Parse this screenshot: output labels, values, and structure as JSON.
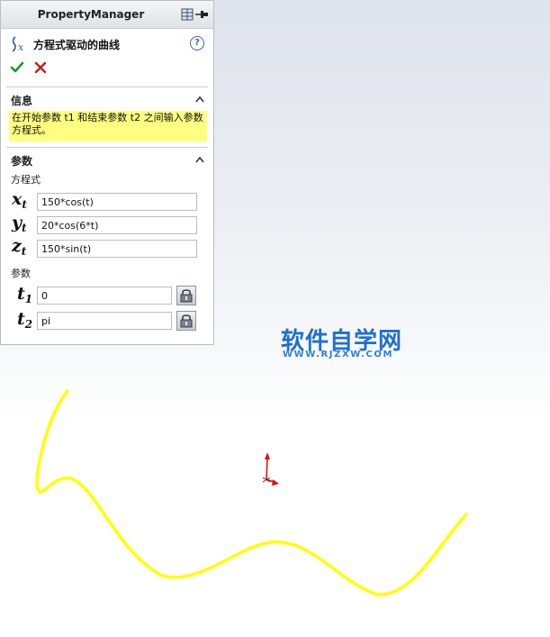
{
  "property_manager": {
    "title": "PropertyManager",
    "feature_title": "方程式驱动的曲线",
    "info": {
      "section_title": "信息",
      "message": "在开始参数 t1 和结束参数 t2 之间输入参数方程式。"
    },
    "params": {
      "section_title": "参数",
      "equations_label": "方程式",
      "equations": [
        {
          "var": "x",
          "sub": "t",
          "value": "150*cos(t)"
        },
        {
          "var": "y",
          "sub": "t",
          "value": "20*cos(6*t)"
        },
        {
          "var": "z",
          "sub": "t",
          "value": "150*sin(t)"
        }
      ],
      "range_label": "参数",
      "range": [
        {
          "var": "t",
          "sub": "1",
          "value": "0"
        },
        {
          "var": "t",
          "sub": "2",
          "value": "pi"
        }
      ]
    }
  },
  "watermark": {
    "text": "软件自学网",
    "url": "WWW.RJZXW.COM"
  },
  "colors": {
    "curve": "#ffff00",
    "info_highlight": "#ffff80",
    "watermark": "#1f6fd0",
    "axis": "#e01010"
  },
  "icons": {
    "feature": "equation-curve-icon",
    "help": "help-icon",
    "ok": "checkmark-icon",
    "cancel": "close-icon",
    "pin": "pushpin-icon",
    "lock": "lock-icon"
  }
}
